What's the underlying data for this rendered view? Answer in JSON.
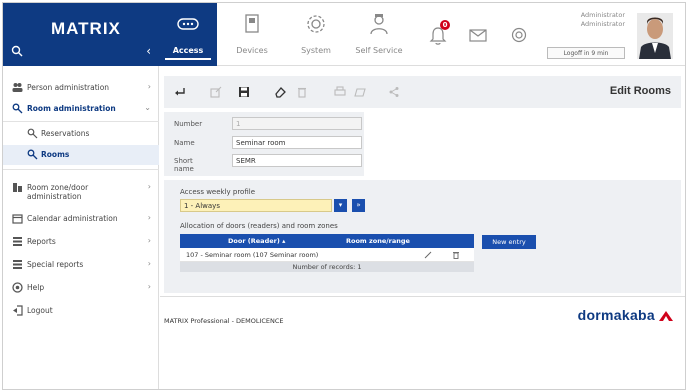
{
  "brand": {
    "title": "MATRIX"
  },
  "topnav": {
    "items": [
      {
        "label": "Access",
        "icon": "access-card-icon",
        "active": true
      },
      {
        "label": "Devices",
        "icon": "devices-icon"
      },
      {
        "label": "System",
        "icon": "system-gear-icon"
      },
      {
        "label": "Self Service",
        "icon": "self-service-icon"
      }
    ],
    "notifications_count": "0",
    "user": {
      "line1": "Administrator",
      "line2": "Administrator",
      "logoff": "Logoff in 9 min"
    }
  },
  "sidebar": {
    "items": [
      {
        "label": "Person administration",
        "icon": "people-icon"
      },
      {
        "label": "Room administration",
        "icon": "room-key-icon"
      },
      {
        "label": "Reservations",
        "icon": "room-key-icon"
      },
      {
        "label": "Rooms",
        "icon": "room-key-icon"
      },
      {
        "label": "Room zone/door",
        "label2": "administration",
        "icon": "door-icon"
      },
      {
        "label": "Calendar administration",
        "icon": "calendar-icon"
      },
      {
        "label": "Reports",
        "icon": "list-icon"
      },
      {
        "label": "Special reports",
        "icon": "list-icon"
      },
      {
        "label": "Help",
        "icon": "help-icon"
      },
      {
        "label": "Logout",
        "icon": "logout-icon"
      }
    ]
  },
  "page": {
    "title": "Edit Rooms"
  },
  "form": {
    "number_label": "Number",
    "number_value": "1",
    "name_label": "Name",
    "name_value": "Seminar room",
    "short_label": "Short name",
    "short_value": "SEMR"
  },
  "profile": {
    "label": "Access weekly profile",
    "selected": "1 - Always",
    "allocation_label": "Allocation of doors (readers) and room zones",
    "table": {
      "headers": [
        "Door (Reader) ▴",
        "Room zone/range"
      ],
      "rows": [
        {
          "door": "107 - Seminar room (107 Seminar room)",
          "zone": ""
        }
      ],
      "footer": "Number of records: 1"
    },
    "new_entry": "New entry"
  },
  "footer": {
    "text": "MATRIX Professional - DEMOLICENCE",
    "logo": "dormakaba"
  },
  "colors": {
    "primary": "#0e3a82",
    "button": "#1a4fae",
    "highlight": "#fdf1b8",
    "alert": "#d0021b"
  }
}
